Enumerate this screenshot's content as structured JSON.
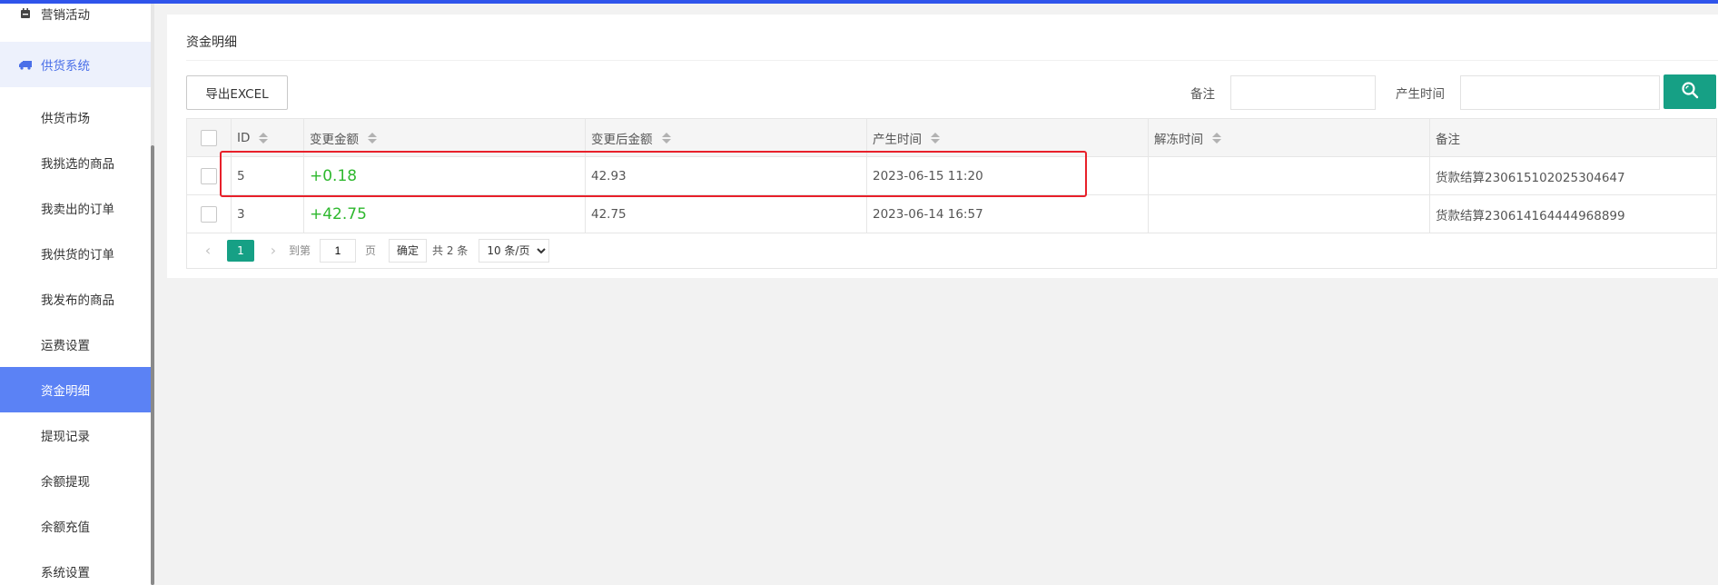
{
  "colors": {
    "accent": "#16a085",
    "sidebar_active": "#5b82f5",
    "amount_green": "#2eb82e",
    "highlight_red": "#e8202a"
  },
  "sidebar": {
    "items": [
      {
        "label": "营销活动",
        "icon": "calendar-icon",
        "kind": "group"
      },
      {
        "label": "供货系统",
        "icon": "truck-icon",
        "kind": "group-active"
      },
      {
        "label": "供货市场",
        "kind": "sub"
      },
      {
        "label": "我挑选的商品",
        "kind": "sub"
      },
      {
        "label": "我卖出的订单",
        "kind": "sub"
      },
      {
        "label": "我供货的订单",
        "kind": "sub"
      },
      {
        "label": "我发布的商品",
        "kind": "sub"
      },
      {
        "label": "运费设置",
        "kind": "sub"
      },
      {
        "label": "资金明细",
        "kind": "active"
      },
      {
        "label": "提现记录",
        "kind": "sub"
      },
      {
        "label": "余额提现",
        "kind": "sub"
      },
      {
        "label": "余额充值",
        "kind": "sub"
      },
      {
        "label": "系统设置",
        "kind": "sub"
      }
    ]
  },
  "main": {
    "title": "资金明细",
    "export_label": "导出EXCEL",
    "filters": {
      "remark_label": "备注",
      "time_label": "产生时间",
      "remark_value": "",
      "time_value": ""
    },
    "search_icon": "search-icon"
  },
  "table": {
    "headers": [
      "ID",
      "变更金额",
      "变更后金额",
      "产生时间",
      "解冻时间",
      "备注"
    ],
    "rows": [
      {
        "id": "5",
        "amount": "+0.18",
        "after": "42.93",
        "time": "2023-06-15 11:20",
        "unfreeze": "",
        "remark": "货款结算230615102025304647"
      },
      {
        "id": "3",
        "amount": "+42.75",
        "after": "42.75",
        "time": "2023-06-14 16:57",
        "unfreeze": "",
        "remark": "货款结算230614164444968899"
      }
    ]
  },
  "pager": {
    "current": "1",
    "goto_label": "到第",
    "goto_value": "1",
    "page_unit": "页",
    "confirm_label": "确定",
    "total_label": "共 2 条",
    "page_size": "10 条/页"
  }
}
